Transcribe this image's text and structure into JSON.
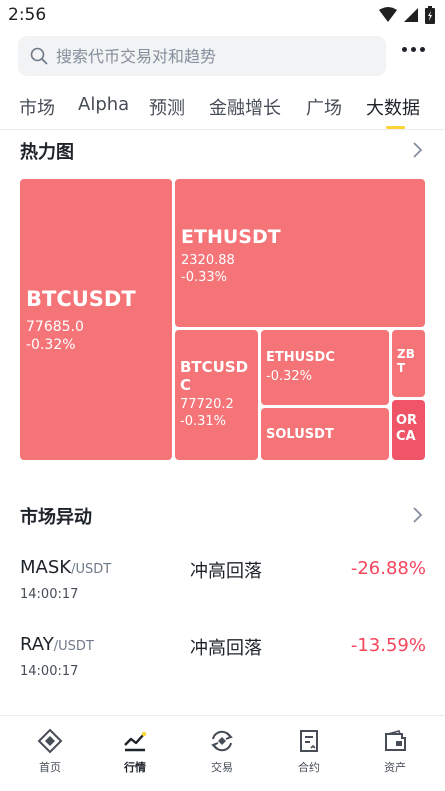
{
  "status_bar": {
    "time": "2:56"
  },
  "search": {
    "placeholder": "搜索代币交易对和趋势"
  },
  "tabs": [
    {
      "label": "市场"
    },
    {
      "label": "Alpha"
    },
    {
      "label": "预测"
    },
    {
      "label": "金融增长"
    },
    {
      "label": "广场"
    },
    {
      "label": "大数据",
      "active": true
    }
  ],
  "heatmap": {
    "title": "热力图",
    "tiles": [
      {
        "symbol": "BTCUSDT",
        "price": "77685.0",
        "change": "-0.32%"
      },
      {
        "symbol": "ETHUSDT",
        "price": "2320.88",
        "change": "-0.33%"
      },
      {
        "symbol": "BTCUSDC",
        "price": "77720.2",
        "change": "-0.31%"
      },
      {
        "symbol": "ETHUSDC",
        "change": "-0.32%"
      },
      {
        "symbol": "ZBT"
      },
      {
        "symbol": "SOLUSDT"
      },
      {
        "symbol": "ORCA"
      }
    ]
  },
  "movers": {
    "title": "市场异动",
    "rows": [
      {
        "base": "MASK",
        "quote": "/USDT",
        "time": "14:00:17",
        "type": "冲高回落",
        "change": "-26.88%"
      },
      {
        "base": "RAY",
        "quote": "/USDT",
        "time": "14:00:17",
        "type": "冲高回落",
        "change": "-13.59%"
      }
    ]
  },
  "bottom_nav": [
    {
      "label": "首页",
      "icon": "home-diamond-icon"
    },
    {
      "label": "行情",
      "icon": "markets-chart-icon",
      "active": true
    },
    {
      "label": "交易",
      "icon": "trade-swap-icon"
    },
    {
      "label": "合约",
      "icon": "futures-doc-icon"
    },
    {
      "label": "资产",
      "icon": "wallet-icon"
    }
  ],
  "colors": {
    "accent": "#fcd535",
    "down": "#f6465d",
    "tile_down": "#f47478",
    "tile_down_strong": "#ef5467"
  }
}
